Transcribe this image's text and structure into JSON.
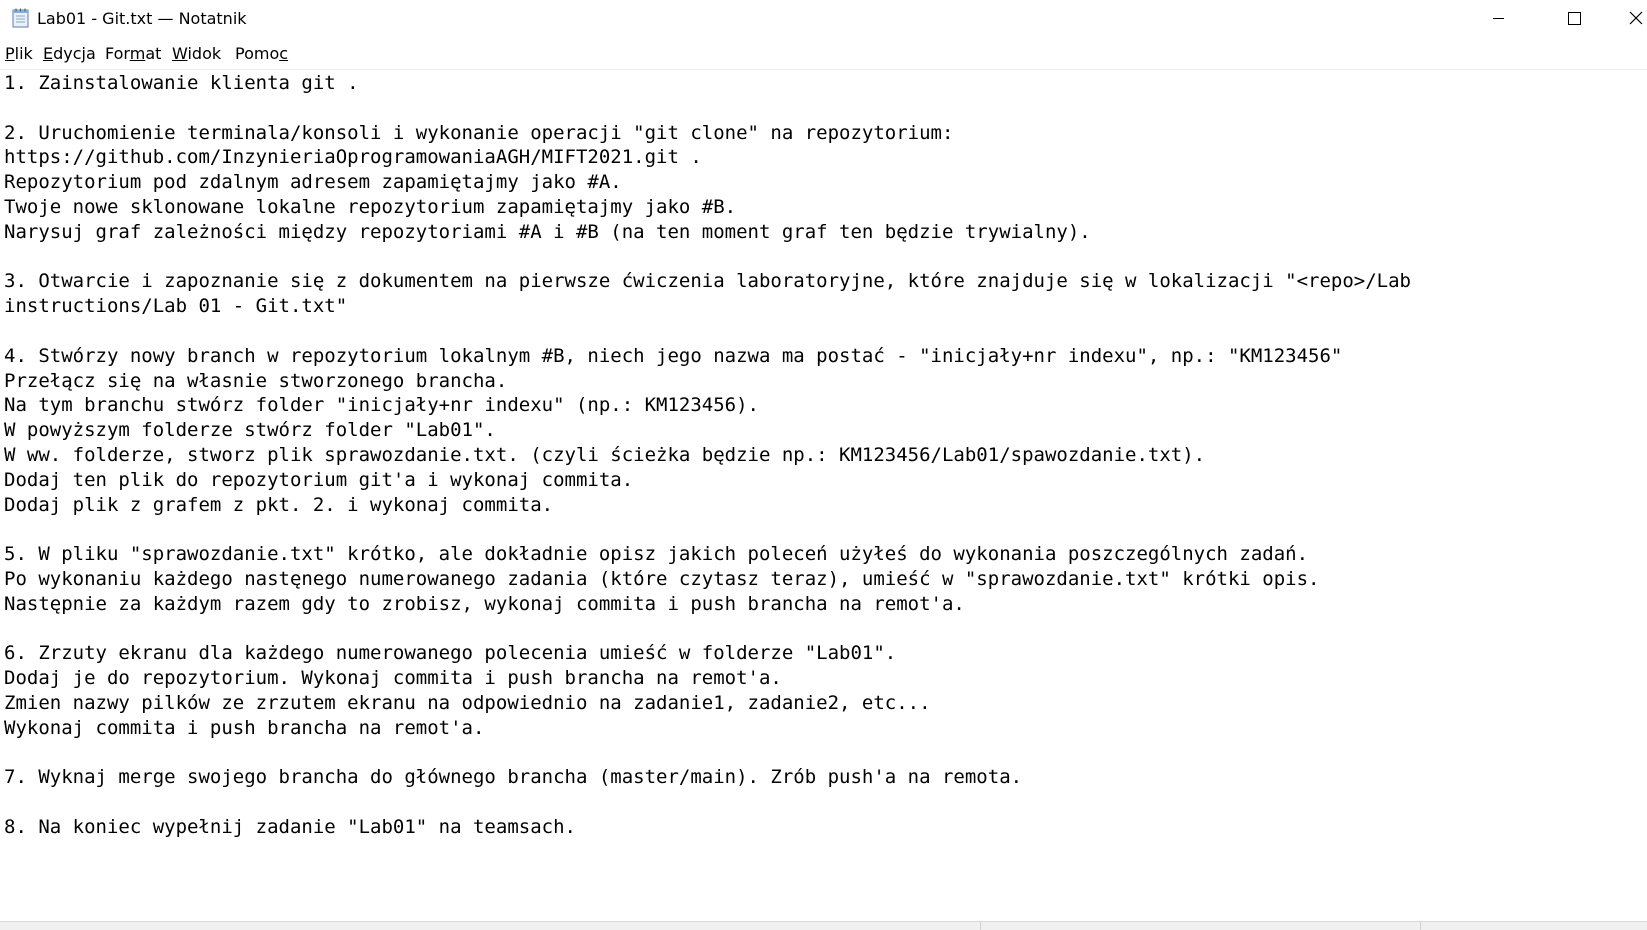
{
  "window": {
    "title": "Lab01 - Git.txt — Notatnik",
    "icon": "notepad-icon",
    "controls": [
      "minimize-icon",
      "maximize-icon",
      "close-icon"
    ]
  },
  "menu": {
    "file": {
      "accel": "P",
      "rest": "lik"
    },
    "edit": {
      "accel": "E",
      "rest": "dycja"
    },
    "format": {
      "pre": "For",
      "accel": "m",
      "rest": "at"
    },
    "view": {
      "accel": "W",
      "rest": "idok"
    },
    "help": {
      "pre": "Pomo",
      "accel": "c",
      "rest": ""
    }
  },
  "document": {
    "content": "1. Zainstalowanie klienta git .\n\n2. Uruchomienie terminala/konsoli i wykonanie operacji \"git clone\" na repozytorium:\nhttps://github.com/InzynieriaOprogramowaniaAGH/MIFT2021.git .\nRepozytorium pod zdalnym adresem zapamiętajmy jako #A.\nTwoje nowe sklonowane lokalne repozytorium zapamiętajmy jako #B.\nNarysuj graf zależności między repozytoriami #A i #B (na ten moment graf ten będzie trywialny).\n\n3. Otwarcie i zapoznanie się z dokumentem na pierwsze ćwiczenia laboratoryjne, które znajduje się w lokalizacji \"<repo>/Lab\ninstructions/Lab 01 - Git.txt\"\n\n4. Stwórzy nowy branch w repozytorium lokalnym #B, niech jego nazwa ma postać - \"inicjały+nr indexu\", np.: \"KM123456\"\nPrzełącz się na własnie stworzonego brancha.\nNa tym branchu stwórz folder \"inicjały+nr indexu\" (np.: KM123456).\nW powyższym folderze stwórz folder \"Lab01\".\nW ww. folderze, stworz plik sprawozdanie.txt. (czyli ścieżka będzie np.: KM123456/Lab01/spawozdanie.txt).\nDodaj ten plik do repozytorium git'a i wykonaj commita.\nDodaj plik z grafem z pkt. 2. i wykonaj commita.\n\n5. W pliku \"sprawozdanie.txt\" krótko, ale dokładnie opisz jakich poleceń użyłeś do wykonania poszczególnych zadań.\nPo wykonaniu każdego nastęnego numerowanego zadania (które czytasz teraz), umieść w \"sprawozdanie.txt\" krótki opis.\nNastępnie za każdym razem gdy to zrobisz, wykonaj commita i push brancha na remot'a.\n\n6. Zrzuty ekranu dla każdego numerowanego polecenia umieść w folderze \"Lab01\".\nDodaj je do repozytorium. Wykonaj commita i push brancha na remot'a.\nZmien nazwy pilków ze zrzutem ekranu na odpowiednio na zadanie1, zadanie2, etc...\nWykonaj commita i push brancha na remot'a.\n\n7. Wyknaj merge swojego brancha do głównego brancha (master/main). Zrób push'a na remota.\n\n8. Na koniec wypełnij zadanie \"Lab01\" na teamsach."
  }
}
